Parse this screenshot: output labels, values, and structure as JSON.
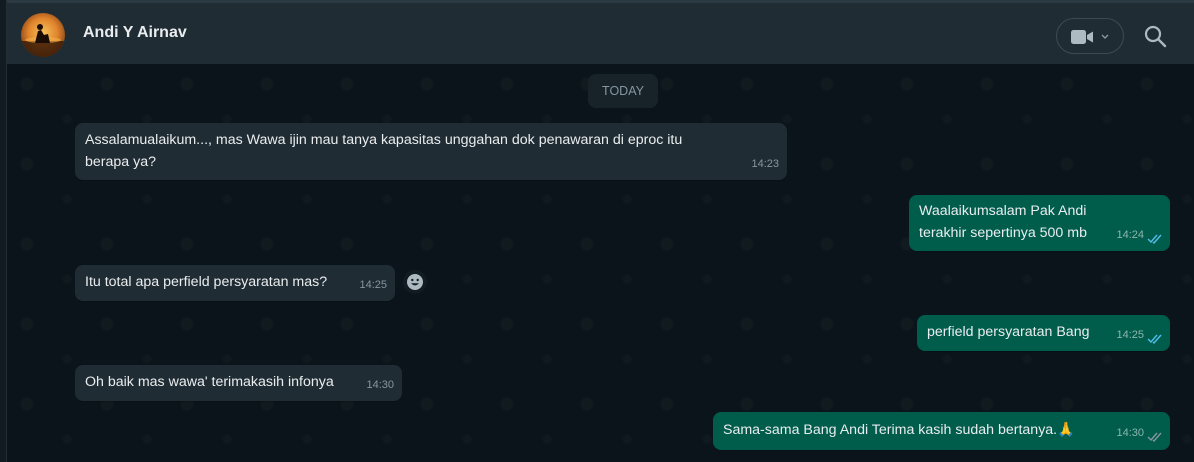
{
  "header": {
    "contact_name": "Andi Y Airnav"
  },
  "chat": {
    "date_label": "TODAY",
    "messages": [
      {
        "direction": "in",
        "line1": "Assalamualaikum..., mas Wawa ijin mau tanya kapasitas unggahan dok penawaran di eproc itu",
        "line2": "berapa ya?",
        "time": "14:23"
      },
      {
        "direction": "out",
        "line1": "Waalaikumsalam Pak Andi",
        "line2": "terakhir sepertinya 500 mb",
        "time": "14:24",
        "status": "read"
      },
      {
        "direction": "in",
        "line1": "Itu total apa perfield persyaratan mas?",
        "time": "14:25"
      },
      {
        "direction": "out",
        "line1": "perfield persyaratan Bang",
        "time": "14:25",
        "status": "read"
      },
      {
        "direction": "in",
        "line1": "Oh baik mas wawa' terimakasih infonya",
        "time": "14:30"
      },
      {
        "direction": "out",
        "line1": "Sama-sama Bang Andi Terima kasih sudah bertanya.",
        "emoji": "🙏",
        "time": "14:30",
        "status": "read"
      }
    ]
  },
  "icons": {
    "video": "video-camera-icon",
    "search": "search-icon",
    "emoji": "smiley-icon",
    "ticks": "double-check-icon"
  },
  "colors": {
    "header_bg": "#202c33",
    "chat_bg": "#0b141a",
    "incoming_bubble": "#202c33",
    "outgoing_bubble": "#005c4b",
    "read_ticks": "#53bdeb"
  }
}
